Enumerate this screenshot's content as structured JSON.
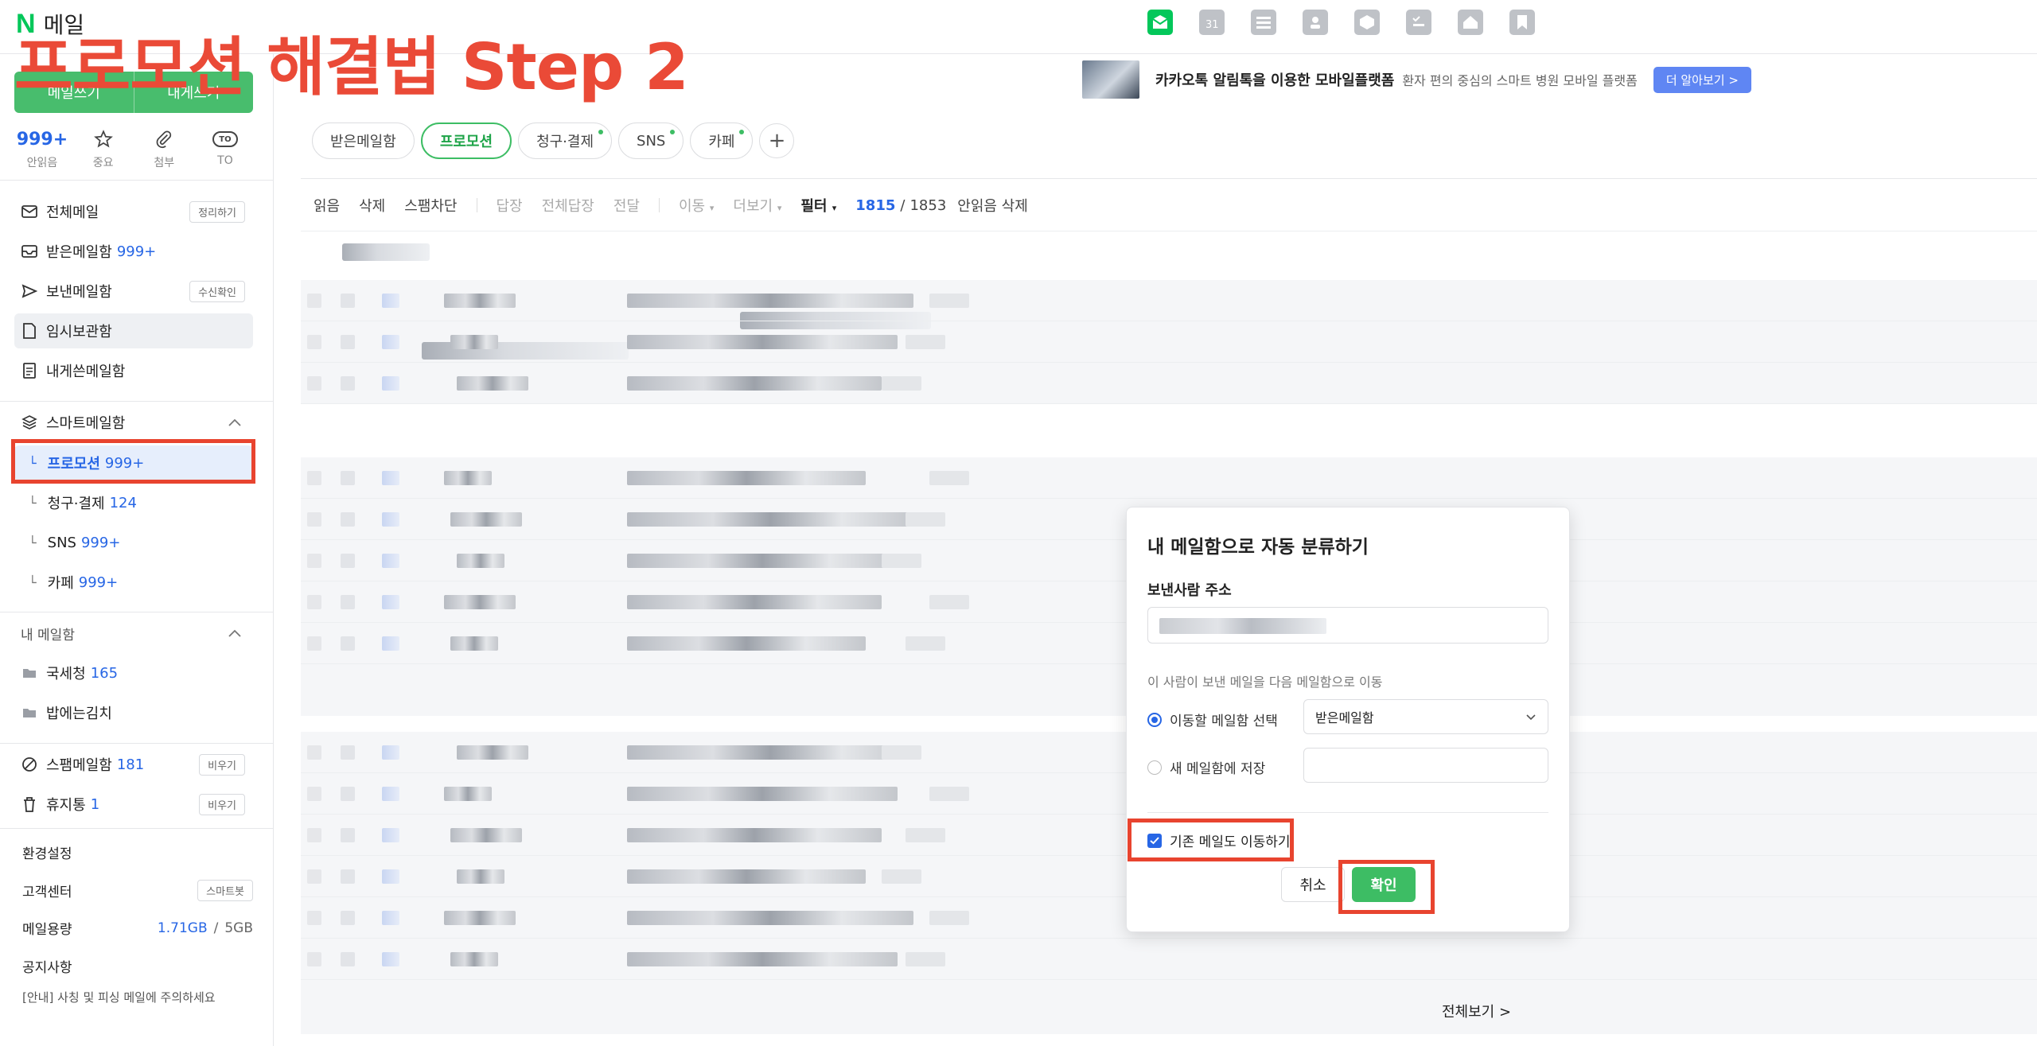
{
  "app": {
    "logo_n": "N",
    "name": "메일"
  },
  "overlay": {
    "title": "프로모션 해결법 Step 2"
  },
  "top_icons": [
    "mail-icon",
    "calendar-icon",
    "list-icon",
    "contacts-icon",
    "box-icon",
    "checklist-icon",
    "home-icon",
    "bookmark-icon"
  ],
  "ad": {
    "title": "카카오톡 알림톡을 이용한 모바일플랫폼",
    "desc": "환자 편의 중심의 스마트 병원 모바일 플랫폼",
    "button": "더 알아보기 >"
  },
  "sidebar": {
    "compose": [
      "메일쓰기",
      "내게쓰기"
    ],
    "quick": [
      {
        "top": "999+",
        "label": "안읽음"
      },
      {
        "icon": "star-icon",
        "label": "중요"
      },
      {
        "icon": "paperclip-icon",
        "label": "첨부"
      },
      {
        "badge": "TO",
        "label": "TO"
      }
    ],
    "folders": [
      {
        "label": "전체메일",
        "pill": "정리하기"
      },
      {
        "label": "받은메일함",
        "count": "999+"
      },
      {
        "label": "보낸메일함",
        "pill": "수신확인"
      },
      {
        "label": "임시보관함"
      },
      {
        "label": "내게쓴메일함"
      }
    ],
    "smart": {
      "title": "스마트메일함",
      "items": [
        {
          "label": "프로모션",
          "count": "999+"
        },
        {
          "label": "청구·결제",
          "count": "124"
        },
        {
          "label": "SNS",
          "count": "999+"
        },
        {
          "label": "카페",
          "count": "999+"
        }
      ]
    },
    "my": {
      "title": "내 메일함",
      "items": [
        {
          "label": "국세청",
          "count": "165"
        },
        {
          "label": "밥에는김치"
        }
      ]
    },
    "spam": {
      "label": "스팸메일함",
      "count": "181",
      "pill": "비우기"
    },
    "trash": {
      "label": "휴지통",
      "count": "1",
      "pill": "비우기"
    },
    "footer": {
      "settings": "환경설정",
      "support": "고객센터",
      "support_pill": "스마트봇",
      "quota_label": "메일용량",
      "quota_used": "1.71GB",
      "quota_sep": "/",
      "quota_total": "5GB",
      "notice_title": "공지사항",
      "notice_text": "[안내] 사칭 및 피싱 메일에 주의하세요"
    }
  },
  "tabs": [
    {
      "label": "받은메일함"
    },
    {
      "label": "프로모션",
      "active": true
    },
    {
      "label": "청구·결제",
      "dot": true
    },
    {
      "label": "SNS",
      "dot": true
    },
    {
      "label": "카페",
      "dot": true
    }
  ],
  "toolbar": {
    "read": "읽음",
    "delete": "삭제",
    "spam_block": "스팸차단",
    "reply": "답장",
    "reply_all": "전체답장",
    "forward": "전달",
    "move": "이동",
    "more": "더보기",
    "filter": "필터",
    "unread_count": "1815",
    "slash": "/",
    "total_count": "1853",
    "delete_unread": "안읽음 삭제"
  },
  "see_all": "전체보기 >",
  "dialog": {
    "title": "내 메일함으로 자동 분류하기",
    "sender_label": "보낸사람 주소",
    "desc": "이 사람이 보낸 메일을 다음 메일함으로 이동",
    "option_select": "이동할 메일함 선택",
    "option_new": "새 메일함에 저장",
    "selected_folder": "받은메일함",
    "move_existing": "기존 메일도 이동하기",
    "cancel": "취소",
    "confirm": "확인"
  },
  "colors": {
    "brand_green": "#03c75a",
    "accent_blue": "#2766e5",
    "highlight_red": "#e8442f"
  }
}
